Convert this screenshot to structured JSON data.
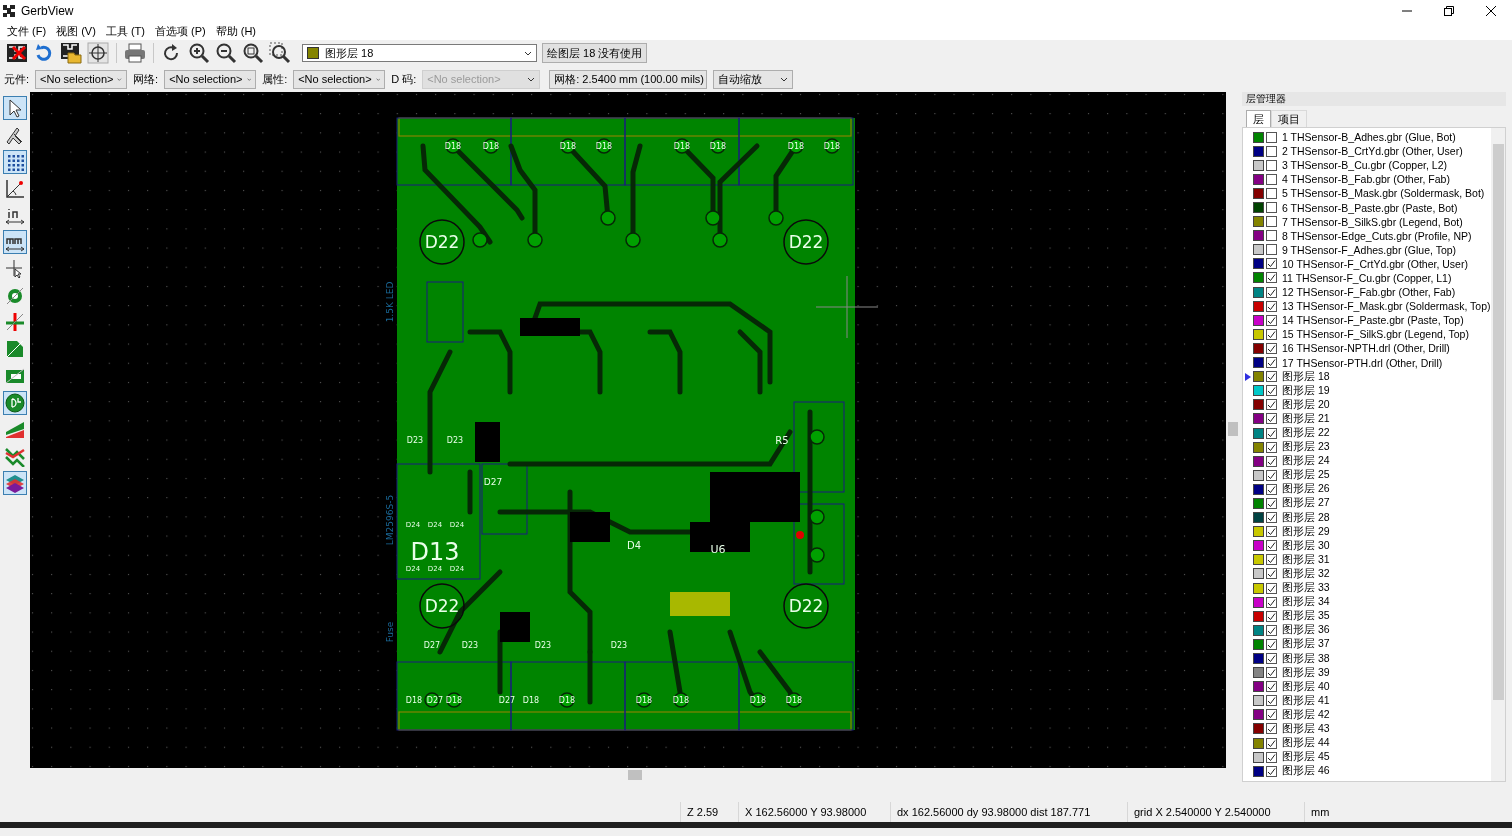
{
  "window": {
    "title": "GerbView"
  },
  "menu": [
    "文件 (F)",
    "视图 (V)",
    "工具 (T)",
    "首选项 (P)",
    "帮助 (H)"
  ],
  "layer_select": {
    "color": "#848400",
    "value": "图形层 18"
  },
  "layer_button": "绘图层 18 没有使用",
  "options_bar": [
    {
      "label": "元件:",
      "value": "<No selection>",
      "disabled": false
    },
    {
      "label": "网络:",
      "value": "<No selection>",
      "disabled": false
    },
    {
      "label": "属性:",
      "value": "<No selection>",
      "disabled": false
    },
    {
      "label": "D 码:",
      "value": "<No selection>",
      "disabled": true
    }
  ],
  "grid_select": "网格: 2.5400 mm (100.00 mils)",
  "zoom_select": "自动缩放",
  "left_tools": [
    {
      "kind": "select",
      "active": true
    },
    {
      "kind": "measure",
      "active": false
    },
    {
      "kind": "grid",
      "active": true
    },
    {
      "kind": "polar",
      "active": false
    },
    {
      "kind": "inch",
      "active": false
    },
    {
      "kind": "mm",
      "active": true
    },
    {
      "kind": "cursor",
      "active": false
    },
    {
      "kind": "flash",
      "active": false
    },
    {
      "kind": "lines",
      "active": false
    },
    {
      "kind": "polygon",
      "active": false
    },
    {
      "kind": "negative",
      "active": false
    },
    {
      "kind": "dcode",
      "active": true
    },
    {
      "kind": "layers",
      "active": false
    },
    {
      "kind": "diff",
      "active": false
    },
    {
      "kind": "stack",
      "active": true
    }
  ],
  "pcb": {
    "labels": [
      "D18",
      "D18",
      "D18",
      "D18",
      "D18",
      "D18",
      "D18",
      "D18",
      "D22",
      "D22",
      "1.5K LED",
      "D23",
      "D23",
      "R5",
      "D27",
      "LM2596S-5",
      "D24",
      "D24",
      "D24",
      "D13",
      "D4",
      "U6",
      "D24",
      "D24",
      "D24",
      "D22",
      "D22",
      "Fuse",
      "D27",
      "D23",
      "D23",
      "D23",
      "D18",
      "D27",
      "D18",
      "D27",
      "D18",
      "D18",
      "D18",
      "D18",
      "D18",
      "D18"
    ]
  },
  "layers_panel": {
    "title": "层管理器",
    "tabs": [
      {
        "label": "层",
        "selected": true
      },
      {
        "label": "项目",
        "selected": false
      }
    ],
    "layers": [
      {
        "name": "1 THSensor-B_Adhes.gbr (Glue, Bot)",
        "color": "#008400",
        "visible": false,
        "selected": false
      },
      {
        "name": "2 THSensor-B_CrtYd.gbr (Other, User)",
        "color": "#000084",
        "visible": false,
        "selected": false
      },
      {
        "name": "3 THSensor-B_Cu.gbr (Copper, L2)",
        "color": "#c8c8c8",
        "visible": false,
        "selected": false
      },
      {
        "name": "4 THSensor-B_Fab.gbr (Other, Fab)",
        "color": "#840084",
        "visible": false,
        "selected": false
      },
      {
        "name": "5 THSensor-B_Mask.gbr (Soldermask, Bot)",
        "color": "#840000",
        "visible": false,
        "selected": false
      },
      {
        "name": "6 THSensor-B_Paste.gbr (Paste, Bot)",
        "color": "#004200",
        "visible": false,
        "selected": false
      },
      {
        "name": "7 THSensor-B_SilkS.gbr (Legend, Bot)",
        "color": "#848400",
        "visible": false,
        "selected": false
      },
      {
        "name": "8 THSensor-Edge_Cuts.gbr (Profile, NP)",
        "color": "#840084",
        "visible": false,
        "selected": false
      },
      {
        "name": "9 THSensor-F_Adhes.gbr (Glue, Top)",
        "color": "#c8c8c8",
        "visible": false,
        "selected": false
      },
      {
        "name": "10 THSensor-F_CrtYd.gbr (Other, User)",
        "color": "#000084",
        "visible": true,
        "selected": false
      },
      {
        "name": "11 THSensor-F_Cu.gbr (Copper, L1)",
        "color": "#008400",
        "visible": true,
        "selected": false
      },
      {
        "name": "12 THSensor-F_Fab.gbr (Other, Fab)",
        "color": "#008484",
        "visible": true,
        "selected": false
      },
      {
        "name": "13 THSensor-F_Mask.gbr (Soldermask, Top)",
        "color": "#c80000",
        "visible": true,
        "selected": false
      },
      {
        "name": "14 THSensor-F_Paste.gbr (Paste, Top)",
        "color": "#c800c8",
        "visible": true,
        "selected": false
      },
      {
        "name": "15 THSensor-F_SilkS.gbr (Legend, Top)",
        "color": "#c8c800",
        "visible": true,
        "selected": false
      },
      {
        "name": "16 THSensor-NPTH.drl (Other, Drill)",
        "color": "#840000",
        "visible": true,
        "selected": false
      },
      {
        "name": "17 THSensor-PTH.drl (Other, Drill)",
        "color": "#000084",
        "visible": true,
        "selected": false
      },
      {
        "name": "图形层 18",
        "color": "#848400",
        "visible": true,
        "selected": true
      },
      {
        "name": "图形层 19",
        "color": "#00c8c8",
        "visible": true,
        "selected": false
      },
      {
        "name": "图形层 20",
        "color": "#840000",
        "visible": true,
        "selected": false
      },
      {
        "name": "图形层 21",
        "color": "#840084",
        "visible": true,
        "selected": false
      },
      {
        "name": "图形层 22",
        "color": "#008484",
        "visible": true,
        "selected": false
      },
      {
        "name": "图形层 23",
        "color": "#848400",
        "visible": true,
        "selected": false
      },
      {
        "name": "图形层 24",
        "color": "#840084",
        "visible": true,
        "selected": false
      },
      {
        "name": "图形层 25",
        "color": "#c8c8c8",
        "visible": true,
        "selected": false
      },
      {
        "name": "图形层 26",
        "color": "#000084",
        "visible": true,
        "selected": false
      },
      {
        "name": "图形层 27",
        "color": "#008400",
        "visible": true,
        "selected": false
      },
      {
        "name": "图形层 28",
        "color": "#004242",
        "visible": true,
        "selected": false
      },
      {
        "name": "图形层 29",
        "color": "#c8c800",
        "visible": true,
        "selected": false
      },
      {
        "name": "图形层 30",
        "color": "#c800c8",
        "visible": true,
        "selected": false
      },
      {
        "name": "图形层 31",
        "color": "#c8c800",
        "visible": true,
        "selected": false
      },
      {
        "name": "图形层 32",
        "color": "#c8c8c8",
        "visible": true,
        "selected": false
      },
      {
        "name": "图形层 33",
        "color": "#c8c800",
        "visible": true,
        "selected": false
      },
      {
        "name": "图形层 34",
        "color": "#c800c8",
        "visible": true,
        "selected": false
      },
      {
        "name": "图形层 35",
        "color": "#c80000",
        "visible": true,
        "selected": false
      },
      {
        "name": "图形层 36",
        "color": "#008484",
        "visible": true,
        "selected": false
      },
      {
        "name": "图形层 37",
        "color": "#008400",
        "visible": true,
        "selected": false
      },
      {
        "name": "图形层 38",
        "color": "#000084",
        "visible": true,
        "selected": false
      },
      {
        "name": "图形层 39",
        "color": "#848484",
        "visible": true,
        "selected": false
      },
      {
        "name": "图形层 40",
        "color": "#840084",
        "visible": true,
        "selected": false
      },
      {
        "name": "图形层 41",
        "color": "#c8c8c8",
        "visible": true,
        "selected": false
      },
      {
        "name": "图形层 42",
        "color": "#840084",
        "visible": true,
        "selected": false
      },
      {
        "name": "图形层 43",
        "color": "#840000",
        "visible": true,
        "selected": false
      },
      {
        "name": "图形层 44",
        "color": "#848400",
        "visible": true,
        "selected": false
      },
      {
        "name": "图形层 45",
        "color": "#c8c8c8",
        "visible": true,
        "selected": false
      },
      {
        "name": "图形层 46",
        "color": "#000084",
        "visible": true,
        "selected": false
      }
    ]
  },
  "status_bar": [
    "Z 2.59",
    "X 162.56000  Y 93.98000",
    "dx 162.56000  dy 93.98000  dist 187.771",
    "grid X 2.540000  Y 2.540000",
    "mm"
  ]
}
